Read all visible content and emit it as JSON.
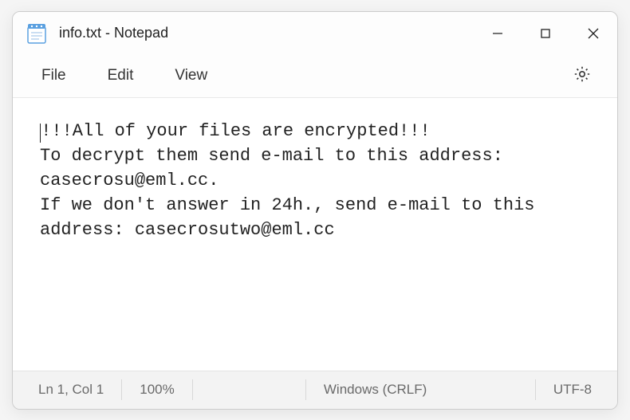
{
  "window": {
    "title": "info.txt - Notepad"
  },
  "menu": {
    "file": "File",
    "edit": "Edit",
    "view": "View"
  },
  "editor": {
    "content": "!!!All of your files are encrypted!!!\nTo decrypt them send e-mail to this address: casecrosu@eml.cc.\nIf we don't answer in 24h., send e-mail to this address: casecrosutwo@eml.cc"
  },
  "status": {
    "position": "Ln 1, Col 1",
    "zoom": "100%",
    "line_ending": "Windows (CRLF)",
    "encoding": "UTF-8"
  }
}
